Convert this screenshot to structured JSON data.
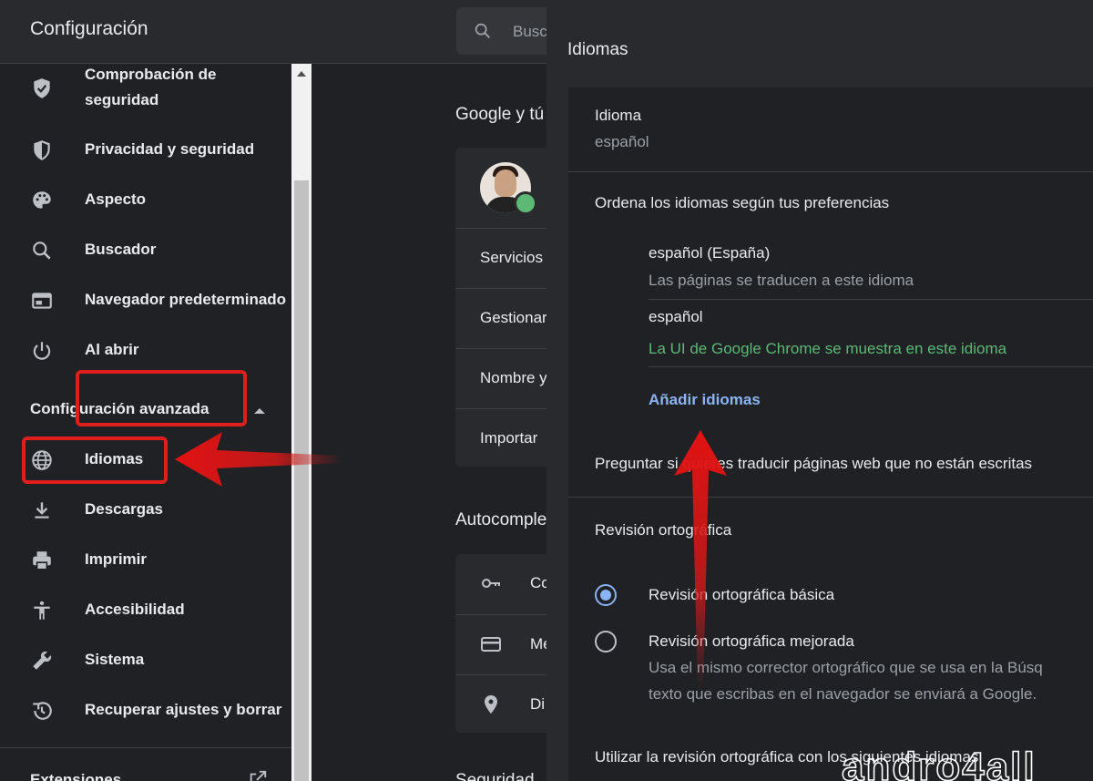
{
  "header": {
    "title": "Configuración",
    "search_placeholder": "Busc"
  },
  "sidebar": {
    "items": [
      {
        "label": "Comprobación de",
        "label2": "seguridad",
        "icon": "shield-check-icon"
      },
      {
        "label": "Privacidad y seguridad",
        "icon": "shield-icon"
      },
      {
        "label": "Aspecto",
        "icon": "palette-icon"
      },
      {
        "label": "Buscador",
        "icon": "search-icon"
      },
      {
        "label": "Navegador predeterminado",
        "icon": "browser-icon"
      },
      {
        "label": "Al abrir",
        "icon": "power-icon"
      }
    ],
    "advanced_label": "Configuración avanzada",
    "advanced_items": [
      {
        "label": "Idiomas",
        "icon": "globe-icon",
        "highlighted": true
      },
      {
        "label": "Descargas",
        "icon": "download-icon"
      },
      {
        "label": "Imprimir",
        "icon": "printer-icon"
      },
      {
        "label": "Accesibilidad",
        "icon": "accessibility-icon"
      },
      {
        "label": "Sistema",
        "icon": "wrench-icon"
      },
      {
        "label": "Recuperar ajustes y borrar",
        "icon": "restore-icon"
      }
    ],
    "extensions_label": "Extensiones"
  },
  "middle": {
    "section1_title": "Google y tú",
    "rows1": [
      "Servicios",
      "Gestionar",
      "Nombre y",
      "Importar"
    ],
    "section2_title": "Autocomple",
    "rows2": [
      "Co",
      "Mé",
      "Di"
    ],
    "section3_title": "Seguridad"
  },
  "panel": {
    "title": "Idiomas",
    "language_label": "Idioma",
    "language_value": "español",
    "order_label": "Ordena los idiomas según tus preferencias",
    "languages": [
      {
        "name": "español (España)",
        "note": "Las páginas se traducen a este idioma"
      },
      {
        "name": "español",
        "note": "La UI de Google Chrome se muestra en este idioma"
      }
    ],
    "add_languages": "Añadir idiomas",
    "translate_prompt": "Preguntar si quieres traducir páginas web que no están escritas",
    "spellcheck_title": "Revisión ortográfica",
    "spellcheck_options": [
      {
        "label": "Revisión ortográfica básica",
        "selected": true
      },
      {
        "label": "Revisión ortográfica mejorada",
        "selected": false
      }
    ],
    "enhanced_desc_1": "Usa el mismo corrector ortográfico que se usa en la Búsq",
    "enhanced_desc_2": "texto que escribas en el navegador se enviará a Google.",
    "spellcheck_languages": "Utilizar la revisión ortográfica con los siguientes idiomas"
  },
  "watermark": "andro4all",
  "colors": {
    "highlight": "#e01e1e",
    "link": "#8ab4f8",
    "success": "#5bb974"
  }
}
